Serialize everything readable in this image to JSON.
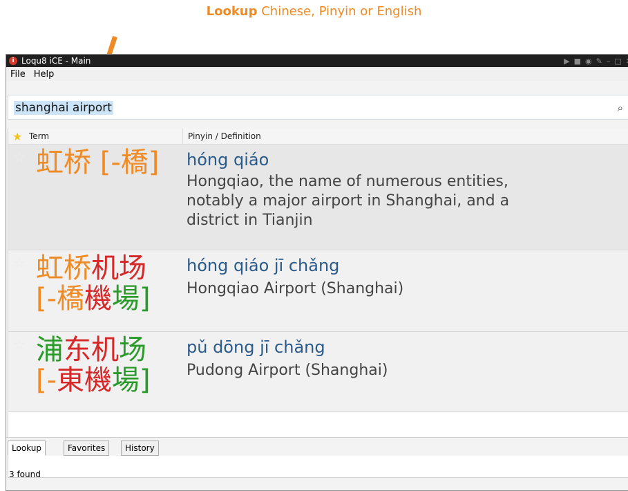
{
  "caption": {
    "bold": "Lookup",
    "rest": " Chinese, Pinyin or English"
  },
  "window": {
    "title": "Loqu8 iCE - Main",
    "controls": [
      "▶",
      "■",
      "◉",
      "✎",
      "–",
      "□",
      "✕"
    ]
  },
  "menu": {
    "file": "File",
    "help": "Help"
  },
  "search": {
    "value": "shanghai airport"
  },
  "columns": {
    "term": "Term",
    "definition": "Pinyin / Definition"
  },
  "results": [
    {
      "term_simplified": "虹桥",
      "term_traditional": "[-橋]",
      "pinyin": "hóng qiáo",
      "definition_lines": [
        "Hongqiao, the name of numerous entities,",
        "notably a major airport in Shanghai, and a",
        "district in Tianjin"
      ]
    },
    {
      "term_simplified_1": "虹桥",
      "term_simplified_2": "机场",
      "term_traditional_1": "[-橋",
      "term_traditional_2": "機",
      "term_traditional_3": "場]",
      "pinyin": "hóng qiáo jī chǎng",
      "definition_lines": [
        "Hongqiao Airport (Shanghai)"
      ]
    },
    {
      "term_simplified_1": "浦",
      "term_simplified_2": "东",
      "term_simplified_3": "机",
      "term_simplified_4": "场",
      "term_traditional_1": "[-",
      "term_traditional_2": "東",
      "term_traditional_3": "機",
      "term_traditional_4": "場]",
      "pinyin": "pǔ dōng jī chǎng",
      "definition_lines": [
        "Pudong Airport (Shanghai)"
      ]
    }
  ],
  "tabs": [
    "Lookup",
    "Favorites",
    "History"
  ],
  "status": "3 found",
  "colors": {
    "annotation": "#f08a24",
    "tone_red": "#d62828",
    "tone_green": "#2a9a2a",
    "pinyin": "#2a5a8a"
  },
  "icons": [
    "app-icon",
    "search-icon",
    "star-icon"
  ]
}
